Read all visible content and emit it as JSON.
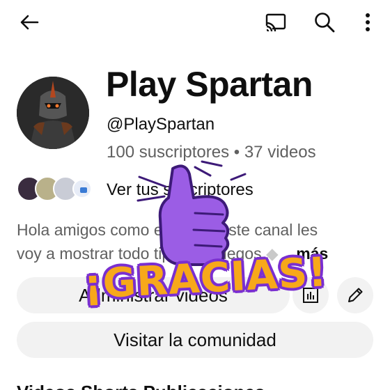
{
  "header": {
    "back_icon": "arrow-left-icon",
    "cast_icon": "cast-icon",
    "search_icon": "search-icon",
    "more_icon": "more-vert-icon"
  },
  "channel": {
    "name": "Play Spartan",
    "handle": "@PlaySpartan",
    "stats": "100 suscriptores • 37 videos",
    "subscribers_link": "Ver tus suscriptores",
    "description_line1": "Hola amigos como están en este canal les",
    "description_line2": "voy a mostrar todo tipos de juegos",
    "description_more": "...más"
  },
  "actions": {
    "manage_videos": "Administrar videos",
    "analytics_icon": "analytics-icon",
    "edit_icon": "pencil-icon",
    "community": "Visitar la comunidad"
  },
  "tabs_partial": "Videos    Shorts    Publicaciones",
  "sticker": {
    "text": "¡GRACIAS!",
    "icon": "thumbs-up-icon",
    "colors": {
      "fill": "#f7a81a",
      "outline": "#7a2fd0",
      "hand": "#9b5de5"
    }
  }
}
